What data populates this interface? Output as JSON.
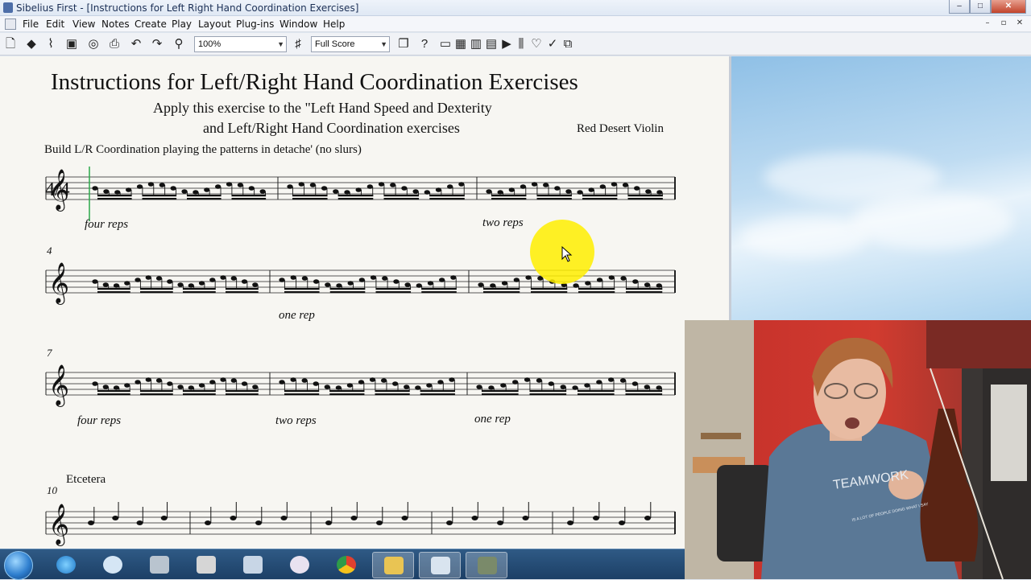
{
  "window": {
    "title": "Sibelius First - [Instructions for Left Right Hand Coordination Exercises]",
    "buttons": [
      "–",
      "□",
      "✕"
    ]
  },
  "menu": {
    "items": [
      "File",
      "Edit",
      "View",
      "Notes",
      "Create",
      "Play",
      "Layout",
      "Plug-ins",
      "Window",
      "Help"
    ],
    "mdi_buttons": [
      "–",
      "▫",
      "✕"
    ]
  },
  "toolbar": {
    "zoom": "100%",
    "view": "Full Score"
  },
  "score": {
    "title": "Instructions for Left/Right Hand Coordination Exercises",
    "subtitle_line1": "Apply this exercise to the \"Left Hand Speed and Dexterity",
    "subtitle_line2": "and Left/Right Hand Coordination exercises",
    "composer": "Red Desert Violin",
    "instruction": "Build L/R Coordination playing the patterns in detache' (no slurs)",
    "time_signature": "4/4",
    "systems": [
      {
        "measure_number": "",
        "annotations": [
          "four reps",
          "two reps"
        ]
      },
      {
        "measure_number": "4",
        "annotations": [
          "one rep"
        ]
      },
      {
        "measure_number": "7",
        "annotations": [
          "four reps",
          "two reps",
          "one rep"
        ]
      },
      {
        "measure_number": "10",
        "annotations": [
          "Etcetera"
        ]
      }
    ]
  },
  "webcam": {
    "shirt_text_1": "TEAMWORK",
    "shirt_text_2": "IS A LOT OF PEOPLE DOING WHAT I SAY"
  },
  "taskbar": {
    "apps": [
      "start",
      "internet-explorer",
      "itunes",
      "media",
      "folder-gray",
      "calculator",
      "paint",
      "chrome",
      "file-explorer",
      "sibelius",
      "sibelius-first"
    ]
  },
  "colors": {
    "accent": "#1c3f66",
    "highlight": "#ffee00",
    "score_bg": "#f7f6f2"
  }
}
